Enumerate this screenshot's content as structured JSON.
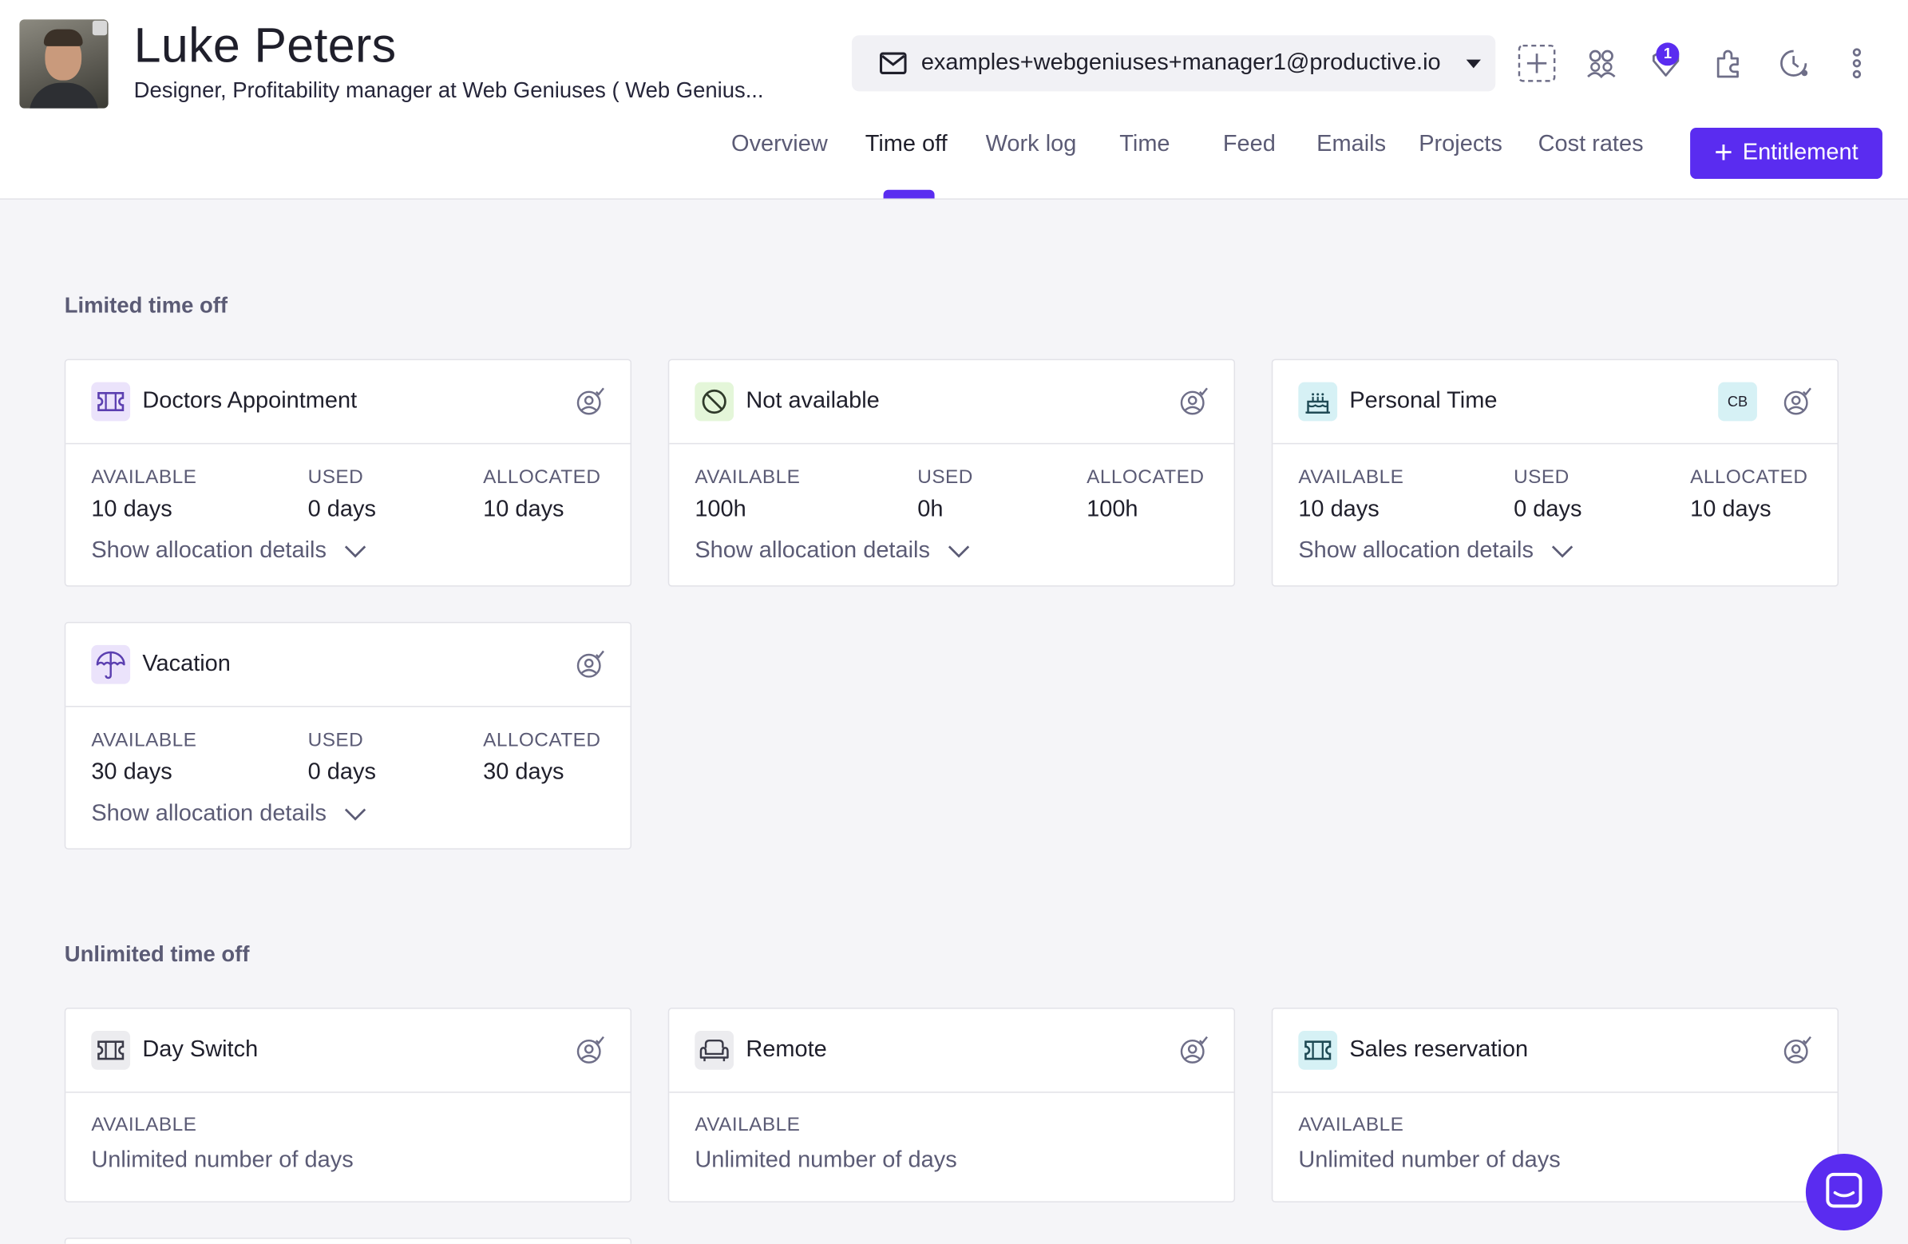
{
  "profile": {
    "name": "Luke Peters",
    "subtitle": "Designer, Profitability manager at Web Geniuses ( Web Genius...",
    "email": "examples+webgeniuses+manager1@productive.io"
  },
  "header_icons": [
    "add-icon",
    "people-icon",
    "notifications-icon",
    "integrations-icon",
    "timer-icon",
    "more-icon"
  ],
  "notification_count": "1",
  "tabs": [
    {
      "label": "Overview"
    },
    {
      "label": "Time off"
    },
    {
      "label": "Work log"
    },
    {
      "label": "Time"
    },
    {
      "label": "Feed"
    },
    {
      "label": "Emails"
    },
    {
      "label": "Projects"
    },
    {
      "label": "Cost rates"
    }
  ],
  "active_tab": "Time off",
  "entitlement_button": {
    "plus": "+",
    "label": "Entitlement"
  },
  "colors": {
    "accent": "#5a2cf0"
  },
  "limited": {
    "title": "Limited time off",
    "cards": [
      {
        "name": "Doctors Appointment",
        "icon": "ticket-icon",
        "available_label": "AVAILABLE",
        "available": "10 days",
        "used_label": "USED",
        "used": "0 days",
        "allocated_label": "ALLOCATED",
        "allocated": "10 days",
        "details": "Show allocation details"
      },
      {
        "name": "Not available",
        "icon": "blocked-icon",
        "available_label": "AVAILABLE",
        "available": "100h",
        "used_label": "USED",
        "used": "0h",
        "allocated_label": "ALLOCATED",
        "allocated": "100h",
        "details": "Show allocation details"
      },
      {
        "name": "Personal Time",
        "icon": "cake-icon",
        "badge": "CB",
        "available_label": "AVAILABLE",
        "available": "10 days",
        "used_label": "USED",
        "used": "0 days",
        "allocated_label": "ALLOCATED",
        "allocated": "10 days",
        "details": "Show allocation details"
      },
      {
        "name": "Vacation",
        "icon": "umbrella-icon",
        "available_label": "AVAILABLE",
        "available": "30 days",
        "used_label": "USED",
        "used": "0 days",
        "allocated_label": "ALLOCATED",
        "allocated": "30 days",
        "details": "Show allocation details"
      }
    ]
  },
  "unlimited": {
    "title": "Unlimited time off",
    "cards": [
      {
        "name": "Day Switch",
        "icon": "ticket-icon",
        "available_label": "AVAILABLE",
        "available": "Unlimited number of days"
      },
      {
        "name": "Remote",
        "icon": "sofa-icon",
        "available_label": "AVAILABLE",
        "available": "Unlimited number of days"
      },
      {
        "name": "Sales reservation",
        "icon": "ticket-icon",
        "available_label": "AVAILABLE",
        "available": "Unlimited number of days"
      }
    ]
  }
}
